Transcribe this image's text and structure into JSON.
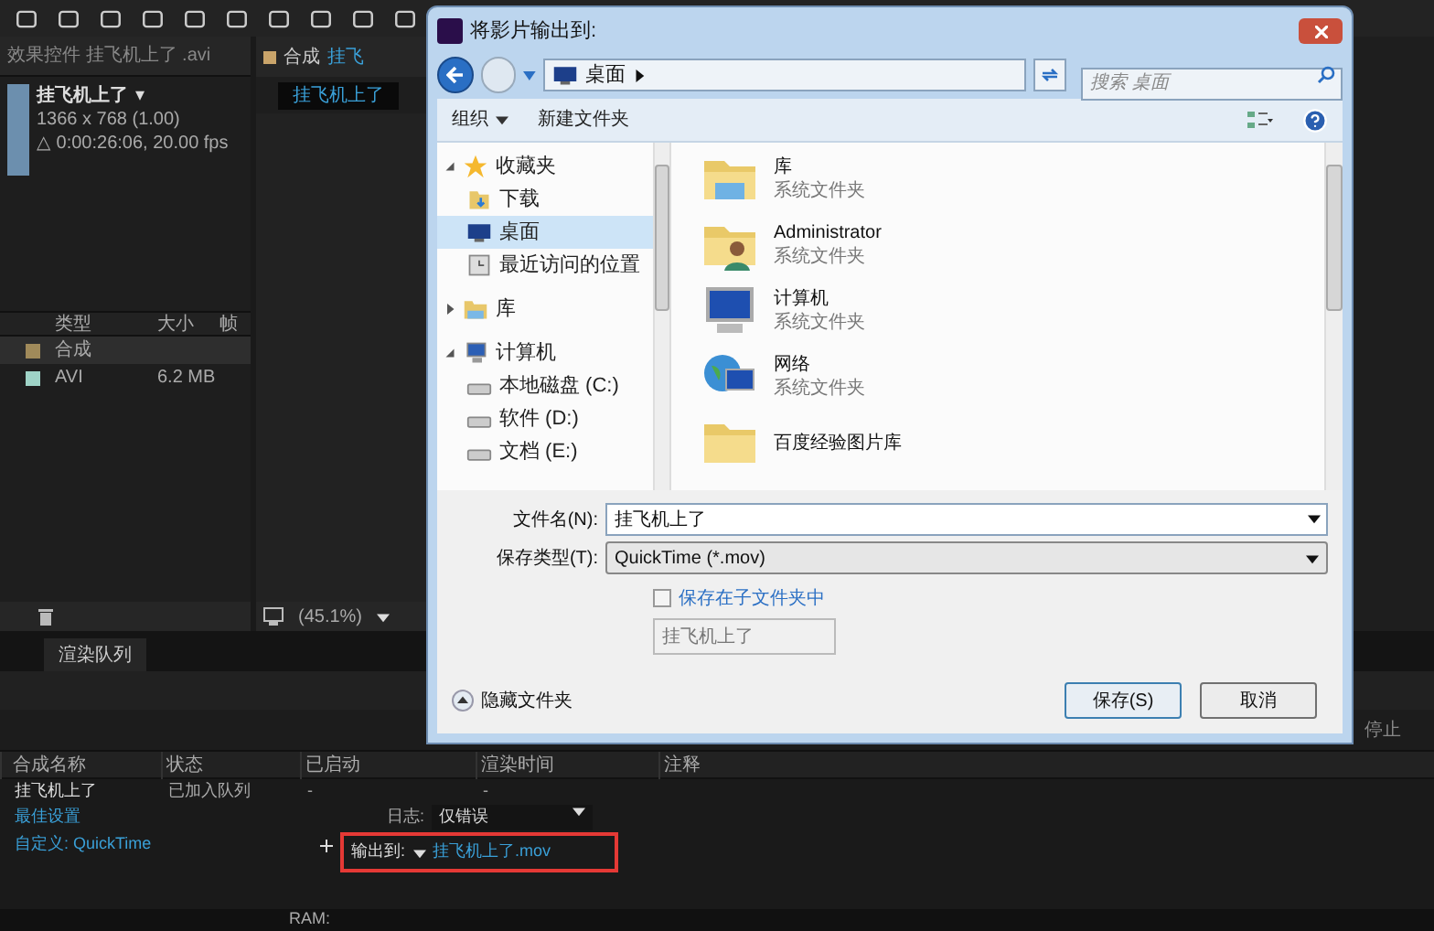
{
  "effects_panel": {
    "tab": "效果控件 挂飞机上了 .avi",
    "footage_name": "挂飞机上了",
    "caret": "▾",
    "dimensions": "1366 x 768 (1.00)",
    "duration": "△ 0:00:26:06, 20.00 fps"
  },
  "project_table": {
    "columns": [
      "类型",
      "大小",
      "帧"
    ],
    "rows": [
      {
        "type": "合成",
        "size": "",
        "color": "#a08a5a",
        "selected": true
      },
      {
        "type": "AVI",
        "size": "6.2 MB",
        "color": "#9fd3c7",
        "selected": false
      }
    ]
  },
  "comp_panel": {
    "tab_label": "合成",
    "tab_name": "挂飞",
    "comp_name": "挂飞机上了",
    "zoom": "(45.1%)"
  },
  "dialog": {
    "title": "将影片输出到:",
    "breadcrumb": "桌面",
    "search_placeholder": "搜索 桌面",
    "organize": "组织",
    "new_folder": "新建文件夹",
    "nav": [
      {
        "label": "收藏夹",
        "kind": "star",
        "expanded": true,
        "children": [
          {
            "label": "下载",
            "kind": "download",
            "selected": false
          },
          {
            "label": "桌面",
            "kind": "desktop",
            "selected": true
          },
          {
            "label": "最近访问的位置",
            "kind": "recent",
            "selected": false
          }
        ]
      },
      {
        "label": "库",
        "kind": "library",
        "expanded": false
      },
      {
        "label": "计算机",
        "kind": "computer",
        "expanded": true,
        "children": [
          {
            "label": "本地磁盘 (C:)",
            "kind": "drive",
            "selected": false
          },
          {
            "label": "软件 (D:)",
            "kind": "drive",
            "selected": false
          },
          {
            "label": "文档 (E:)",
            "kind": "drive",
            "selected": false
          }
        ]
      }
    ],
    "files": [
      {
        "name": "库",
        "kind": "library",
        "subtitle": "系统文件夹"
      },
      {
        "name": "Administrator",
        "kind": "user",
        "subtitle": "系统文件夹"
      },
      {
        "name": "计算机",
        "kind": "computer",
        "subtitle": "系统文件夹"
      },
      {
        "name": "网络",
        "kind": "network",
        "subtitle": "系统文件夹"
      },
      {
        "name": "百度经验图片库",
        "kind": "folder"
      }
    ],
    "filename_label": "文件名(N):",
    "filename": "挂飞机上了",
    "type_label": "保存类型(T):",
    "type_value": "QuickTime (*.mov)",
    "subfolder": {
      "label": "保存在子文件夹中",
      "checked": false
    },
    "subfolder_name": "挂飞机上了",
    "hide_folders": "隐藏文件夹",
    "save": "保存(S)",
    "cancel": "取消"
  },
  "render_queue": {
    "tab": "渲染队列",
    "stop": "停止",
    "columns": [
      "合成名称",
      "状态",
      "已启动",
      "渲染时间",
      "注释"
    ],
    "item": {
      "name": "挂飞机上了",
      "status": "已加入队列",
      "started": "-",
      "render_time": "-"
    },
    "settings": "最佳设置",
    "log_label": "日志:",
    "log_value": "仅错误",
    "module": "自定义: QuickTime",
    "output_label": "输出到:",
    "output_file": "挂飞机上了.mov",
    "ram": "RAM:"
  }
}
